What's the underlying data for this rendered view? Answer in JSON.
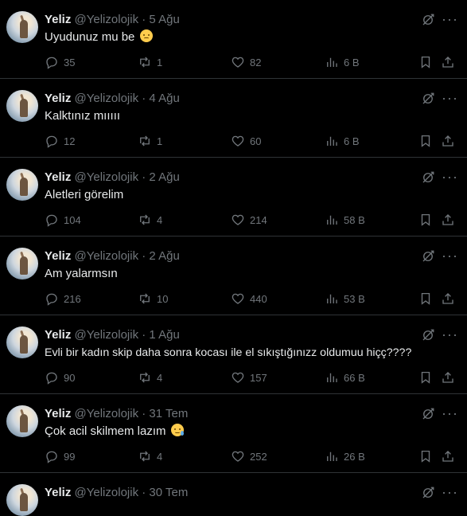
{
  "tweets": [
    {
      "name": "Yeliz",
      "handle": "@Yelizolojik",
      "date": "5 Ağu",
      "text": "Uyudunuz mu be",
      "emoji": "relieved",
      "replies": "35",
      "retweets": "1",
      "likes": "82",
      "views": "6 B"
    },
    {
      "name": "Yeliz",
      "handle": "@Yelizolojik",
      "date": "4 Ağu",
      "text": "Kalktınız mııııı",
      "emoji": "",
      "replies": "12",
      "retweets": "1",
      "likes": "60",
      "views": "6 B"
    },
    {
      "name": "Yeliz",
      "handle": "@Yelizolojik",
      "date": "2 Ağu",
      "text": "Aletleri görelim",
      "emoji": "",
      "replies": "104",
      "retweets": "4",
      "likes": "214",
      "views": "58 B"
    },
    {
      "name": "Yeliz",
      "handle": "@Yelizolojik",
      "date": "2 Ağu",
      "text": "Am yalarmsın",
      "emoji": "",
      "replies": "216",
      "retweets": "10",
      "likes": "440",
      "views": "53 B"
    },
    {
      "name": "Yeliz",
      "handle": "@Yelizolojik",
      "date": "1 Ağu",
      "text": "Evli bir kadın skip daha sonra kocası ile el sıkıştığınızz oldumuu hiçç????",
      "emoji": "",
      "replies": "90",
      "retweets": "4",
      "likes": "157",
      "views": "66 B"
    },
    {
      "name": "Yeliz",
      "handle": "@Yelizolojik",
      "date": "31 Tem",
      "text": "Çok acil skilmem lazım",
      "emoji": "sad-sweat",
      "replies": "99",
      "retweets": "4",
      "likes": "252",
      "views": "26 B"
    },
    {
      "name": "Yeliz",
      "handle": "@Yelizolojik",
      "date": "30 Tem"
    }
  ],
  "separator": "·",
  "more_glyph": "···",
  "icons": {
    "reply": "reply-icon",
    "retweet": "retweet-icon",
    "like": "heart-icon",
    "views": "views-icon",
    "bookmark": "bookmark-icon",
    "share": "share-icon",
    "grok": "grok-icon",
    "more": "more-icon"
  },
  "colors": {
    "background": "#000000",
    "text": "#e7e9ea",
    "muted": "#71767b",
    "divider": "#2f3336"
  }
}
